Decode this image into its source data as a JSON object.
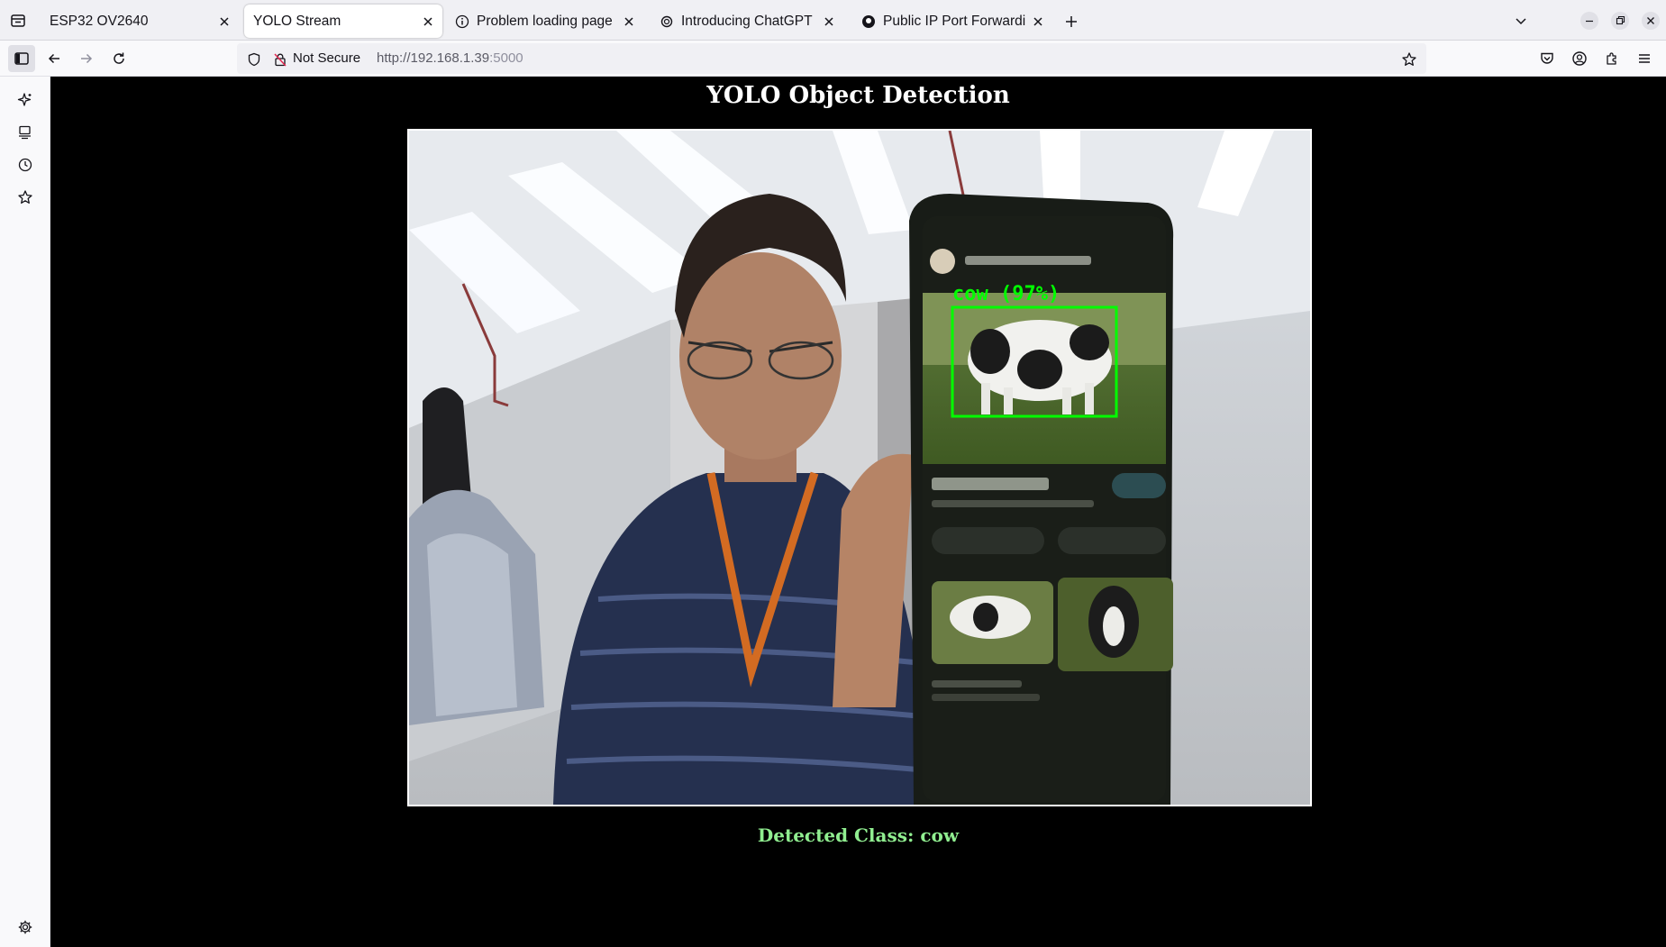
{
  "browser": {
    "tabs": [
      {
        "title": "ESP32 OV2640",
        "active": false
      },
      {
        "title": "YOLO Stream",
        "active": true
      },
      {
        "title": "Problem loading page",
        "active": false
      },
      {
        "title": "Introducing ChatGPT | Op",
        "active": false
      },
      {
        "title": "Public IP Port Forwarding",
        "active": false
      }
    ],
    "security_label": "Not Secure",
    "url_host": "http://192.168.1.39",
    "url_port": ":5000"
  },
  "page": {
    "title": "YOLO Object Detection",
    "detected_class_text": "Detected Class: cow"
  },
  "detection": {
    "label": "cow (97%)",
    "class": "cow",
    "confidence_percent": 97,
    "box_color": "#00ff00"
  },
  "colors": {
    "page_background": "#000000",
    "title_text": "#ffffff",
    "detected_text": "#90ee90"
  }
}
